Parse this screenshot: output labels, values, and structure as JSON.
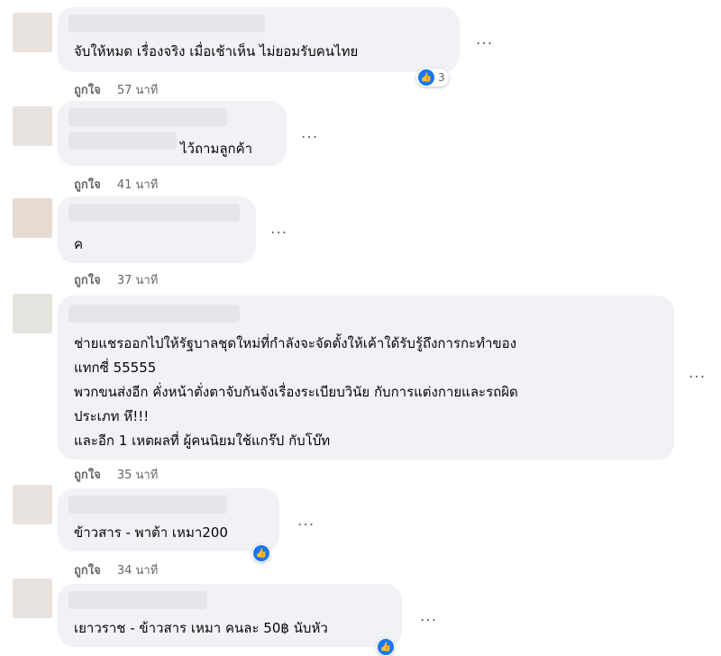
{
  "comments": [
    {
      "text": "จับให้หมด เรื่องจริง เมื่อเช้าเห็น ไม่ยอมรับคนไทย",
      "like_label": "ถูกใจ",
      "time": "57 นาที",
      "reaction_count": "3"
    },
    {
      "text": "ไว้ถามลูกค้า",
      "like_label": "ถูกใจ",
      "time": "41 นาที"
    },
    {
      "text": "ค",
      "like_label": "ถูกใจ",
      "time": "37 นาที"
    },
    {
      "text": "ช่ายแชรออกไปให้รัฐบาลชุดใหม่ที่กำลังจะจัดตั้งให้เค้าใด้รับรู้ถึงการกะทำของ\nแทกซี่ 55555\nพวกขนส่งอีก คั่งหน้าตั่งตาจับกันจังเรื่องระเบียบวินัย กับการแต่งกายและรถผิด\nประเภท หึ!!!\nและอีก 1 เหตผลที่ ผู้คนนิยมใช้แกร๊ป กับโบ๊ท",
      "like_label": "ถูกใจ",
      "time": "35 นาที"
    },
    {
      "text": "ข้าวสาร - พาต้า เหมา200",
      "like_label": "ถูกใจ",
      "time": "34 นาที"
    },
    {
      "text": "เยาวราช - ข้าวสาร เหมา คนละ 50฿ นับหัว"
    }
  ],
  "more_label": "···",
  "thumb_icon": "like-thumb-icon",
  "colors": {
    "bubble": "#f0f2f5",
    "meta": "#65676b",
    "like_blue": "#1877f2"
  }
}
